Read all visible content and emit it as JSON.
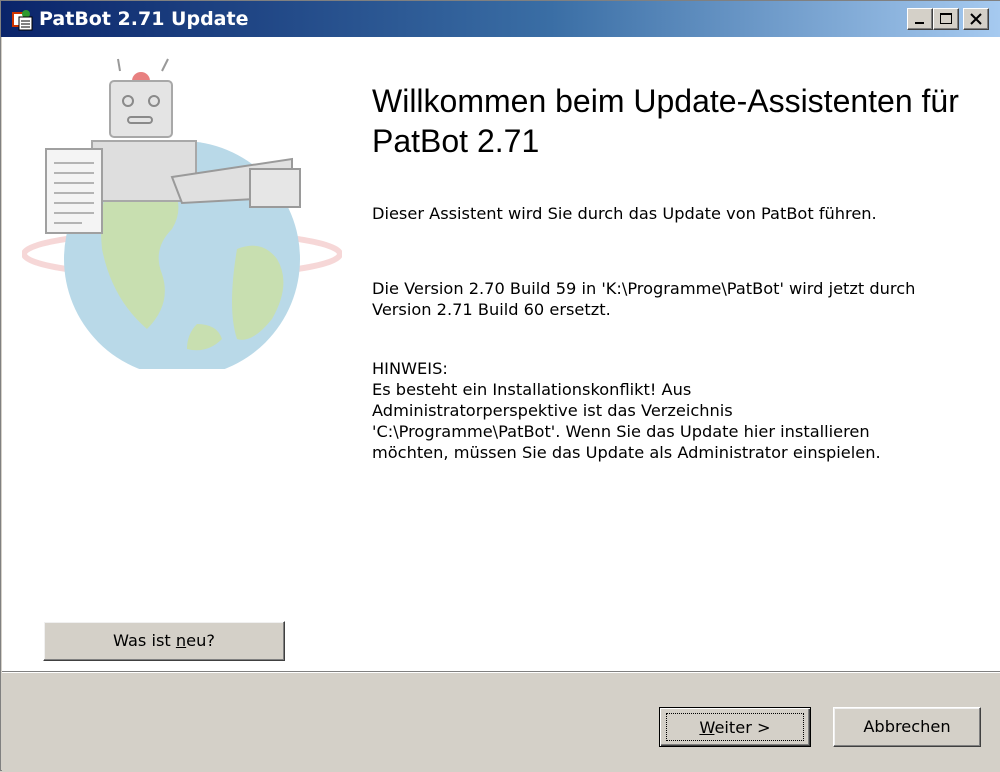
{
  "window": {
    "title": "PatBot 2.71 Update",
    "icon": "patbot-app-icon",
    "controls": [
      "minimize",
      "maximize",
      "close"
    ]
  },
  "main": {
    "heading": "Willkommen beim Update-Assistenten für PatBot 2.71",
    "intro": "Dieser Assistent wird Sie durch das Update von PatBot führen.",
    "version_info": "Die Version 2.70 Build 59 in 'K:\\Programme\\PatBot' wird jetzt durch Version 2.71 Build 60 ersetzt.",
    "notice_label": "HINWEIS:",
    "notice_text": "Es besteht ein Installationskonflikt! Aus Administratorperspektive ist das Verzeichnis 'C:\\Programme\\PatBot'. Wenn Sie das Update hier installieren möchten, müssen Sie das Update als Administrator einspielen."
  },
  "buttons": {
    "whats_new": {
      "before": "Was ist ",
      "accel": "n",
      "after": "eu?"
    },
    "next": {
      "accel": "W",
      "after": "eiter >"
    },
    "cancel": "Abbrechen"
  },
  "colors": {
    "titlebar_start": "#0a246a",
    "titlebar_end": "#a6caf0",
    "dialog_face": "#d4d0c8",
    "content_bg": "#ffffff"
  }
}
